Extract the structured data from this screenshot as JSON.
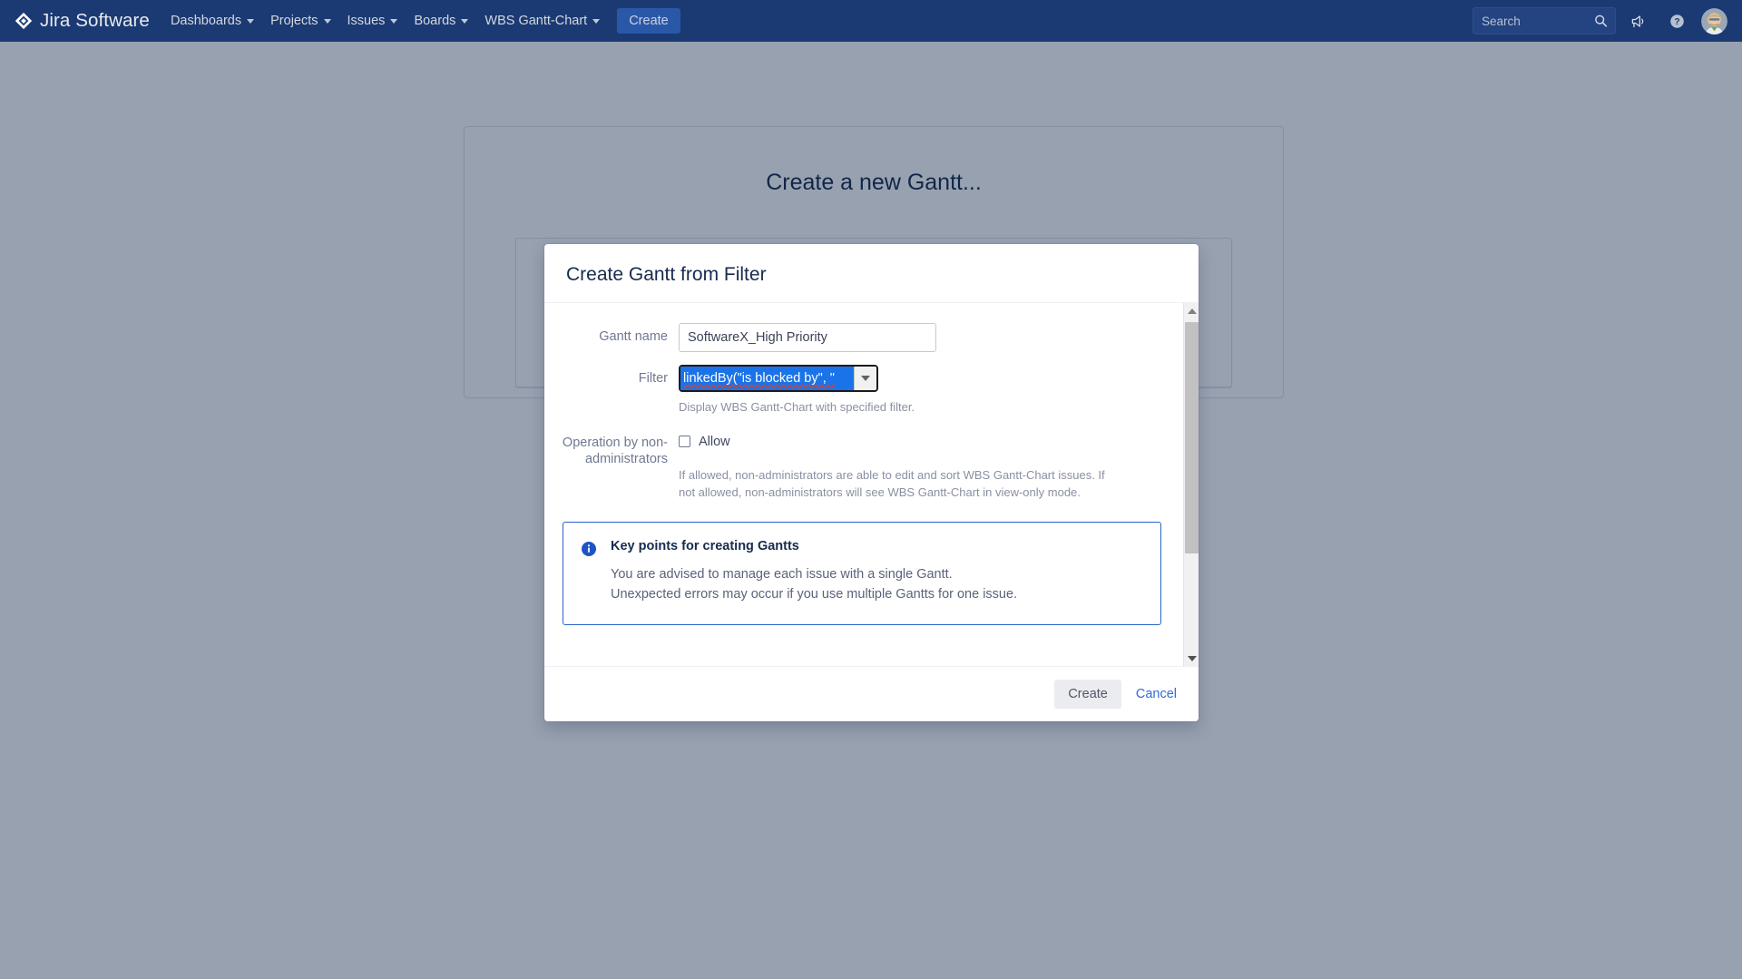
{
  "navbar": {
    "brand": "Jira Software",
    "brand_icon": "jira-diamond-logo",
    "items": [
      {
        "label": "Dashboards",
        "has_caret": true
      },
      {
        "label": "Projects",
        "has_caret": true
      },
      {
        "label": "Issues",
        "has_caret": true
      },
      {
        "label": "Boards",
        "has_caret": true
      },
      {
        "label": "WBS Gantt-Chart",
        "has_caret": true
      }
    ],
    "create_button": "Create",
    "search": {
      "value": "",
      "placeholder": "Search",
      "icon": "search-icon"
    },
    "icons": [
      {
        "name": "megaphone-icon"
      },
      {
        "name": "help-question-icon"
      },
      {
        "name": "avatar"
      }
    ]
  },
  "page": {
    "card_title": "Create a new Gantt..."
  },
  "dialog": {
    "title": "Create Gantt from Filter",
    "fields": {
      "gantt_name": {
        "label": "Gantt name",
        "value": "SoftwareX_High Priority",
        "placeholder": ""
      },
      "filter": {
        "label": "Filter",
        "value": "linkedBy(\"is blocked by\", \"",
        "help": "Display WBS Gantt-Chart with specified filter.",
        "dropdown_icon": "chevron-down-icon"
      },
      "operation": {
        "label": "Operation by non-administrators",
        "checkbox_label": "Allow",
        "checked": false,
        "help_line1": "If allowed, non-administrators are able to edit and sort WBS Gantt-Chart issues. If",
        "help_line2": "not allowed, non-administrators will see WBS Gantt-Chart in view-only mode."
      }
    },
    "info_panel": {
      "icon": "info-circle-icon",
      "title": "Key points for creating Gantts",
      "line1": "You are advised to manage each issue with a single Gantt.",
      "line2": "Unexpected errors may occur if you use multiple Gantts for one issue."
    },
    "footer": {
      "create_label": "Create",
      "cancel_label": "Cancel"
    },
    "scrollbar": {
      "up_icon": "scroll-up-arrow-icon",
      "down_icon": "scroll-down-arrow-icon"
    }
  },
  "colors": {
    "navbar_bg": "#1b3a73",
    "accent_blue": "#2a63c7",
    "selection_blue": "#1a73e8",
    "link_blue": "#2f6bd8",
    "text_dark": "#172b4d",
    "muted": "#8a90a2"
  }
}
